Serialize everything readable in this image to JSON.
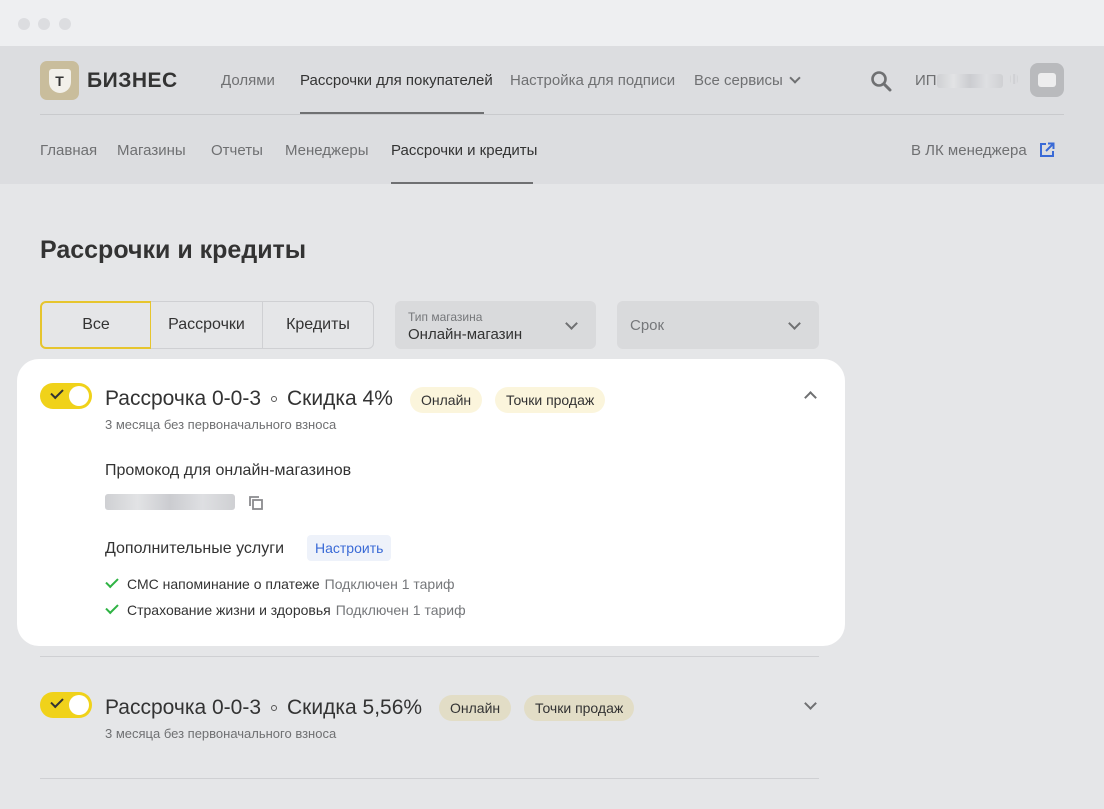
{
  "window": {
    "controls": [
      "close",
      "minimize",
      "maximize"
    ]
  },
  "brand": {
    "logo_letter": "Т",
    "name": "БИЗНЕС"
  },
  "top_nav": {
    "items": [
      "Долями",
      "Рассрочки для покупателей",
      "Настройка для подписи",
      "Все сервисы"
    ],
    "active": "Рассрочки для покупателей"
  },
  "account": {
    "prefix": "ИП",
    "icons": {
      "search": "search-icon",
      "avatar": "briefcase-icon"
    }
  },
  "sub_nav": {
    "items": [
      "Главная",
      "Магазины",
      "Отчеты",
      "Менеджеры",
      "Рассрочки и кредиты"
    ],
    "active": "Рассрочки и кредиты",
    "manager_link": "В ЛК менеджера"
  },
  "page": {
    "title": "Рассрочки и кредиты"
  },
  "filters": {
    "segments": [
      "Все",
      "Рассрочки",
      "Кредиты"
    ],
    "selected_segment": "Все",
    "store_type": {
      "caption": "Тип магазина",
      "value": "Онлайн-магазин"
    },
    "term": {
      "placeholder": "Срок"
    }
  },
  "offers": [
    {
      "enabled": true,
      "expanded": true,
      "name": "Рассрочка 0-0-3",
      "discount": "Скидка 4%",
      "tags": [
        "Онлайн",
        "Точки продаж"
      ],
      "subtitle": "3 месяца без первоначального взноса",
      "promo_heading": "Промокод для онлайн-магазинов",
      "services_heading": "Дополнительные услуги",
      "configure_label": "Настроить",
      "services": [
        {
          "name": "СМС напоминание о платеже",
          "status": "Подключен 1 тариф"
        },
        {
          "name": "Страхование жизни и здоровья",
          "status": "Подключен 1 тариф"
        }
      ]
    },
    {
      "enabled": true,
      "expanded": false,
      "name": "Рассрочка 0-0-3",
      "discount": "Скидка 5,56%",
      "tags": [
        "Онлайн",
        "Точки продаж"
      ],
      "subtitle": "3 месяца без первоначального взноса"
    }
  ],
  "colors": {
    "accent": "#f0d21a",
    "link": "#3a6ad6",
    "check": "#2fb344",
    "tag_bg": "#fbf5dc"
  }
}
